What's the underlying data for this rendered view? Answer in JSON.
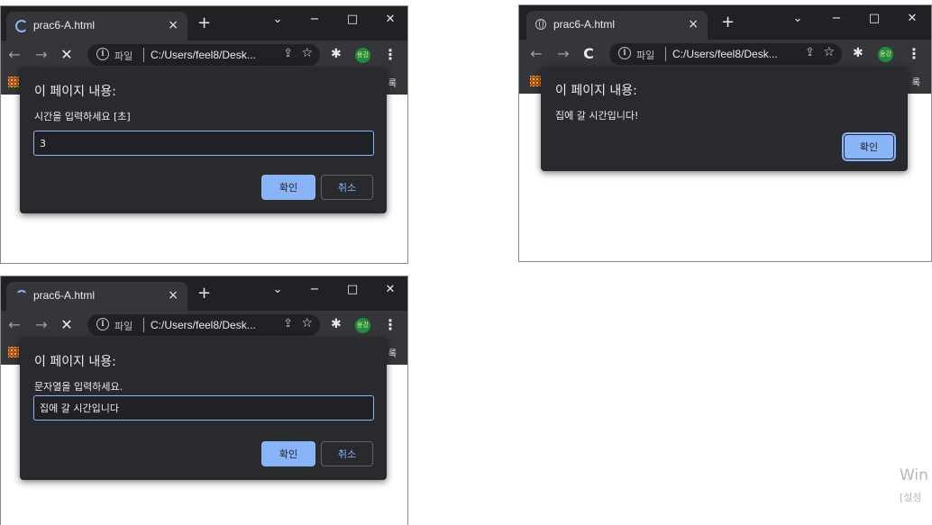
{
  "windows": [
    {
      "tab_title": "prac6-A.html",
      "url_label": "파일",
      "url": "C:/Users/feel8/Desk...",
      "profile_label": "용강",
      "bookmark_tail": "록",
      "dialog_title": "이 페이지 내용:",
      "dialog_message": "시간을 입력하세요 [초]",
      "input_value": "3",
      "ok_label": "확인",
      "cancel_label": "취소"
    },
    {
      "tab_title": "prac6-A.html",
      "url_label": "파일",
      "url": "C:/Users/feel8/Desk...",
      "profile_label": "용강",
      "bookmark_tail": "록",
      "dialog_title": "이 페이지 내용:",
      "dialog_message": "집에 갈 시간입니다!",
      "ok_label": "확인"
    },
    {
      "tab_title": "prac6-A.html",
      "url_label": "파일",
      "url": "C:/Users/feel8/Desk...",
      "profile_label": "용강",
      "bookmark_tail": "록",
      "dialog_title": "이 페이지 내용:",
      "dialog_message": "문자열을 입력하세요.",
      "input_value": "집에 갈 시간입니다",
      "ok_label": "확인",
      "cancel_label": "취소"
    }
  ],
  "watermark": {
    "line1": "Win",
    "line2": "[설정"
  },
  "icons": {
    "close": "×",
    "new_tab": "+",
    "tab_search": "⌄",
    "minimize": "−",
    "maximize": "□",
    "window_close": "✕",
    "back": "←",
    "forward": "→",
    "stop": "✕",
    "reload": "C",
    "info": "i",
    "share": "⇪",
    "star": "☆",
    "puzzle": "✱",
    "kebab": "⋮"
  },
  "colors": {
    "accent": "#8ab4f8",
    "chrome_dark": "#202124",
    "toolbar": "#35363a",
    "dialog": "#292a2d"
  }
}
